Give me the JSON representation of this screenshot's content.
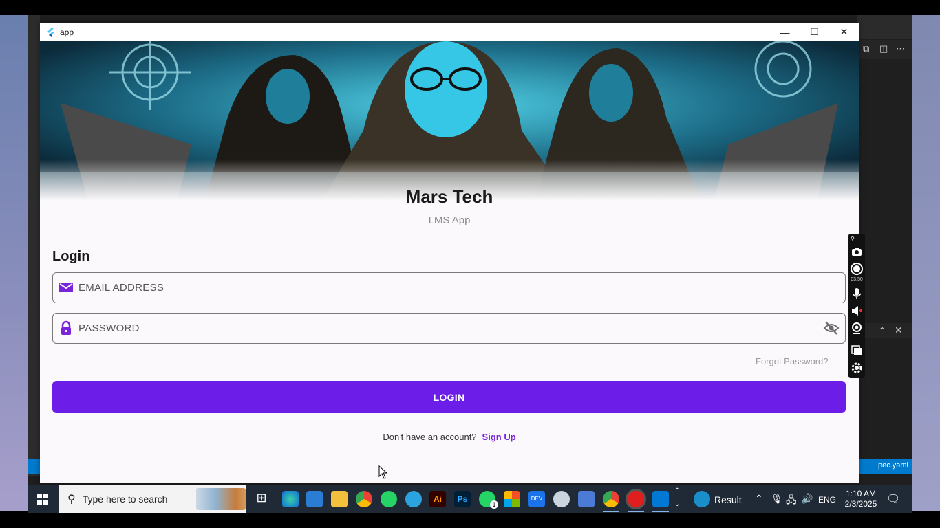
{
  "window": {
    "title": "app",
    "minimize_glyph": "—",
    "maximize_glyph": "☐",
    "close_glyph": "✕"
  },
  "brand": {
    "title": "Mars Tech",
    "subtitle": "LMS App"
  },
  "login": {
    "heading": "Login",
    "email_placeholder": "EMAIL ADDRESS",
    "email_value": "",
    "password_placeholder": "PASSWORD",
    "password_value": "",
    "forgot_label": "Forgot Password?",
    "button_label": "LOGIN",
    "no_account_text": "Don't have an account?",
    "signup_label": "Sign Up"
  },
  "icons": {
    "email": "envelope-icon",
    "password": "lock-icon",
    "visibility": "eye-off-icon"
  },
  "colors": {
    "primary": "#6c1ee8",
    "icon_purple": "#7a24d9",
    "page_bg": "#fbf9fb",
    "taskbar_bg": "#1f2a36",
    "vscode_status": "#007acc"
  },
  "recorder": {
    "elapsed": "03:50"
  },
  "vscode": {
    "status_right": "pec.yaml"
  },
  "taskbar": {
    "search_placeholder": "Type here to search",
    "weather_label": "Result",
    "language": "ENG",
    "time": "1:10 AM",
    "date": "2/3/2025",
    "whatsapp_badge": "1"
  }
}
